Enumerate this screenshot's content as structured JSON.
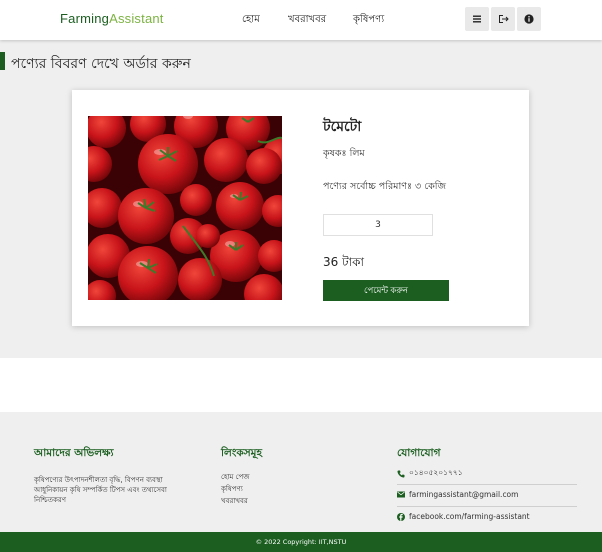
{
  "header": {
    "brand_part1": "Farming",
    "brand_part2": "Assistant",
    "nav": [
      "হোম",
      "খবরাখবর",
      "কৃষিপণ্য"
    ]
  },
  "main": {
    "page_title": "পণ্যের বিবরণ দেখে অর্ডার করুন",
    "product": {
      "name": "টমেটো",
      "farmer": "কৃষকঃ লিম",
      "max_qty": "পণ্যের সর্বোচ্চ পরিমাণঃ ৩ কেজি",
      "quantity": "3",
      "price": "36 টাকা",
      "pay_label": "পেমেন্ট করুন"
    }
  },
  "footer": {
    "mission": {
      "heading": "আমাদের অভিলক্ষ্য",
      "text": "কৃষিপণ্যের উৎপাদনশীলতা বৃদ্ধি, বিপণন ব্যবস্থা আধুনিকায়ন কৃষি সম্পর্কিত টিপস এবং তথ্যসেবা নিশ্চিতকরণ"
    },
    "links": {
      "heading": "লিংকসমূহ",
      "items": [
        "হোম পেজ",
        "কৃষিপণ্য",
        "খবরাখবর"
      ]
    },
    "contact": {
      "heading": "যোগাযোগ",
      "phone": "০১৪০৫২০১৭৭১",
      "email": "farmingassistant@gmail.com",
      "facebook": "facebook.com/farming-assistant"
    },
    "copyright": "© 2022 Copyright: IIT,NSTU"
  },
  "colors": {
    "primary": "#1b5e20",
    "brand_accent": "#7cb342",
    "section_bg": "#efefef"
  },
  "icons": [
    "menu-icon",
    "logout-icon",
    "info-icon",
    "phone-icon",
    "email-icon",
    "facebook-icon"
  ]
}
